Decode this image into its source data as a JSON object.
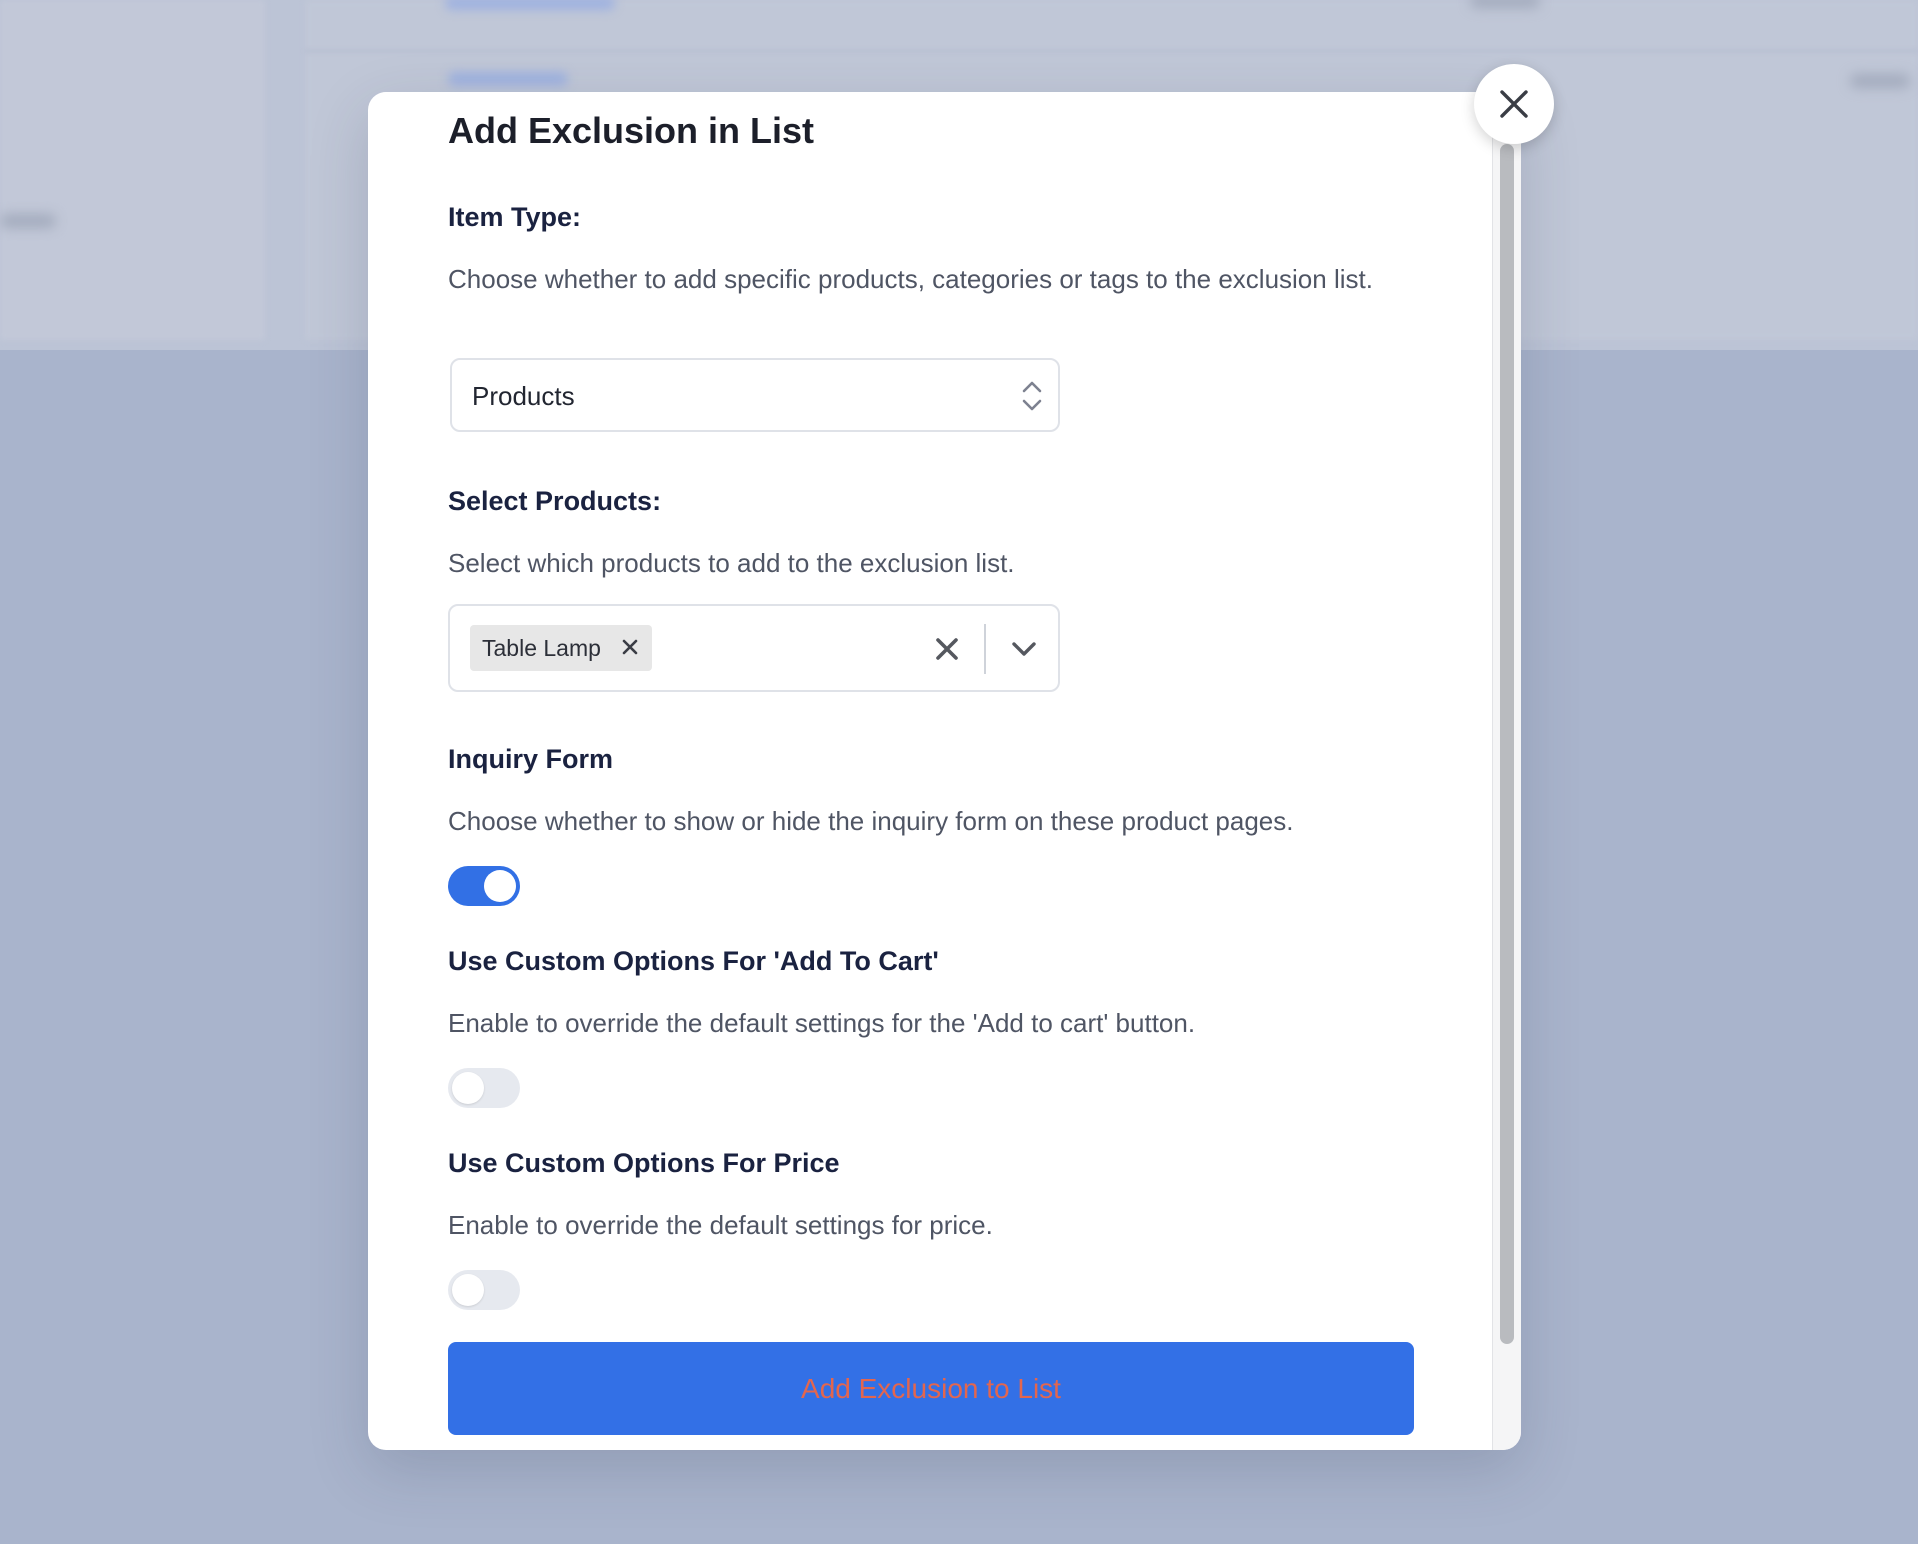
{
  "modal": {
    "title": "Add Exclusion in List",
    "item_type": {
      "label": "Item Type:",
      "description": "Choose whether to add specific products, categories or tags to the exclusion list.",
      "selected": "Products"
    },
    "select_products": {
      "label": "Select Products:",
      "description": "Select which products to add to the exclusion list.",
      "chips": [
        "Table Lamp"
      ]
    },
    "inquiry_form": {
      "label": "Inquiry Form",
      "description": "Choose whether to show or hide the inquiry form on these product pages.",
      "enabled": true
    },
    "custom_add_to_cart": {
      "label": "Use Custom Options For 'Add To Cart'",
      "description": "Enable to override the default settings for the 'Add to cart' button.",
      "enabled": false
    },
    "custom_price": {
      "label": "Use Custom Options For Price",
      "description": "Enable to override the default settings for price.",
      "enabled": false
    },
    "submit_label": "Add Exclusion to List",
    "close_icon": "close-icon"
  },
  "colors": {
    "accent": "#3370e6",
    "submit_text": "#e3664e",
    "toggle_off": "#e6e9ef"
  }
}
